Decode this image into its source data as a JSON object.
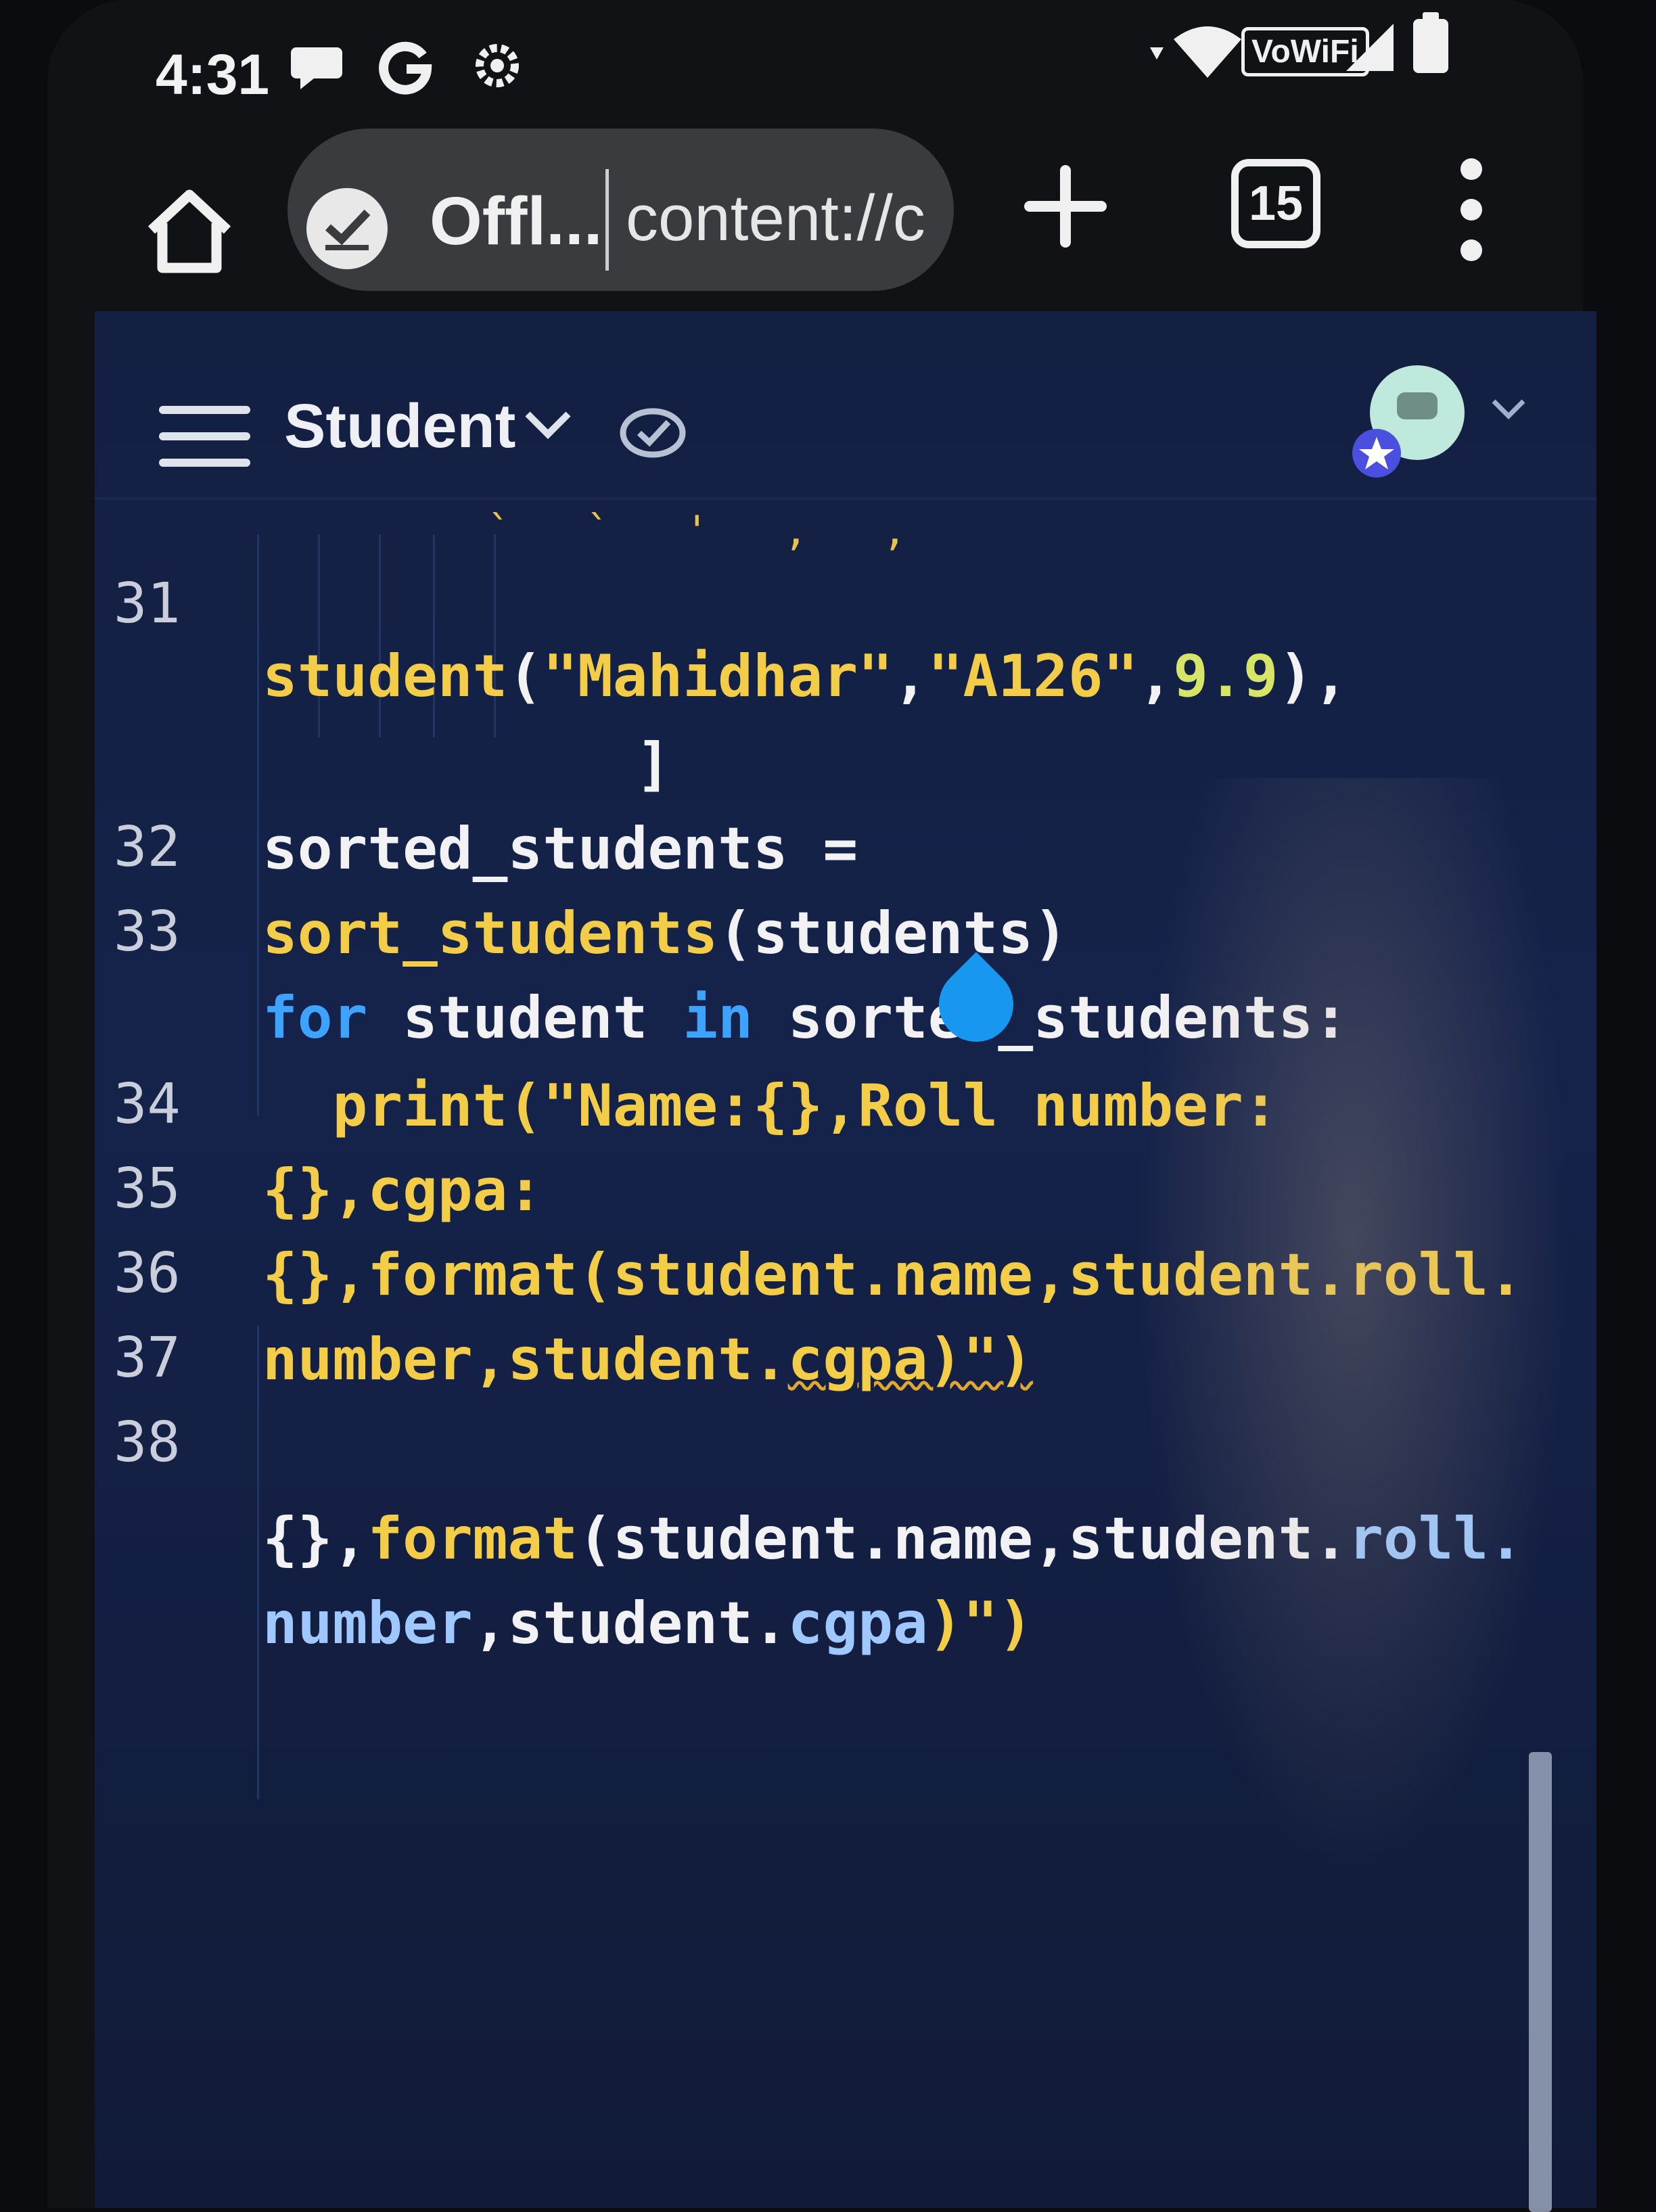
{
  "status_bar": {
    "time": "4:31",
    "notification_icons": [
      "chat-icon",
      "google-icon",
      "settings-icon"
    ],
    "wifi_label": "VoWiFi",
    "system_icons": [
      "wifi-icon",
      "signal-icon",
      "battery-icon"
    ]
  },
  "browser": {
    "offline_label": "Offl...",
    "url_text": "content://c",
    "tab_count": "15"
  },
  "editor": {
    "file_title": "Student",
    "lines": [
      {
        "num": "31"
      },
      {
        "student_call": "student",
        "open_paren": "(",
        "arg_name": "\"Mahidhar\"",
        "comma1": ",",
        "arg_roll": "\"A126\"",
        "comma2": ",",
        "arg_cgpa": "9.9",
        "close": "),"
      },
      {
        "bracket": "]"
      },
      {
        "num": "32",
        "text": "sorted_students ="
      },
      {
        "num": "33",
        "func": "sort_students",
        "rest": "(students)"
      },
      {
        "kw_for": "for",
        "var": " student ",
        "kw_in": "in",
        "rest": " sorted_students:"
      },
      {
        "num": "34",
        "text": "  print(\"Name:{},Roll number:"
      },
      {
        "num": "35",
        "text": "{},cgpa:"
      },
      {
        "num": "36",
        "text": "{},format(student.name,student.roll."
      },
      {
        "num": "37",
        "text_a": "number,student.",
        "text_b": "cgpa)\")"
      },
      {
        "num": "38"
      },
      {
        "text_a": "{},",
        "func": "format",
        "text_b": "(student.name,student.",
        "text_c": "roll."
      },
      {
        "text_a": "number",
        "text_b": ",student.",
        "text_c": "cgpa",
        "text_d": ")\")"
      }
    ]
  },
  "colors": {
    "editor_bg": "#15224a",
    "keyword": "#3ea3ff",
    "function": "#f3cd47",
    "number": "#d6e566",
    "selection_handle": "#1797f0"
  }
}
